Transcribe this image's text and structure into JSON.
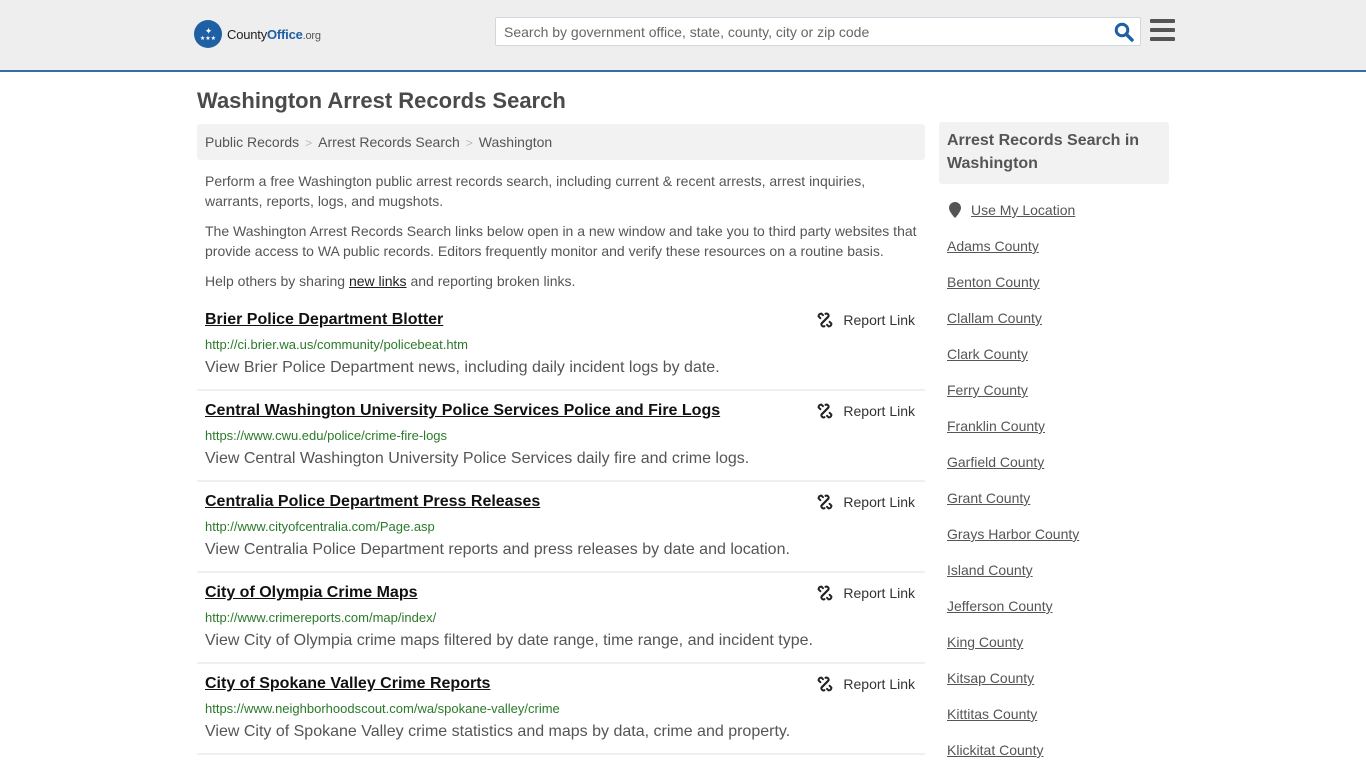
{
  "header": {
    "logo": {
      "brand_prefix": "County",
      "brand_office": "Office",
      "brand_tld": ".org",
      "wing_glyph": "✦",
      "stars_glyph": "★★★"
    },
    "search": {
      "placeholder": "Search by government office, state, county, city or zip code",
      "value": ""
    },
    "icons": {
      "search": "search-icon",
      "menu": "hamburger-menu-icon"
    }
  },
  "page": {
    "title": "Washington Arrest Records Search"
  },
  "breadcrumb": [
    {
      "label": "Public Records"
    },
    {
      "label": "Arrest Records Search"
    },
    {
      "label": "Washington"
    }
  ],
  "breadcrumb_separator": ">",
  "intro": {
    "p1": "Perform a free Washington public arrest records search, including current & recent arrests, arrest inquiries, warrants, reports, logs, and mugshots.",
    "p2": "The Washington Arrest Records Search links below open in a new window and take you to third party websites that provide access to WA public records. Editors frequently monitor and verify these resources on a routine basis.",
    "p3_before": "Help others by sharing ",
    "p3_link": "new links",
    "p3_after": " and reporting broken links."
  },
  "report_link_label": "Report Link",
  "results": [
    {
      "title": "Brier Police Department Blotter",
      "url": "http://ci.brier.wa.us/community/policebeat.htm",
      "description": "View Brier Police Department news, including daily incident logs by date."
    },
    {
      "title": "Central Washington University Police Services Police and Fire Logs",
      "url": "https://www.cwu.edu/police/crime-fire-logs",
      "description": "View Central Washington University Police Services daily fire and crime logs."
    },
    {
      "title": "Centralia Police Department Press Releases",
      "url": "http://www.cityofcentralia.com/Page.asp",
      "description": "View Centralia Police Department reports and press releases by date and location."
    },
    {
      "title": "City of Olympia Crime Maps",
      "url": "http://www.crimereports.com/map/index/",
      "description": "View City of Olympia crime maps filtered by date range, time range, and incident type."
    },
    {
      "title": "City of Spokane Valley Crime Reports",
      "url": "https://www.neighborhoodscout.com/wa/spokane-valley/crime",
      "description": "View City of Spokane Valley crime statistics and maps by data, crime and property."
    }
  ],
  "sidebar": {
    "heading": "Arrest Records Search in Washington",
    "use_location": "Use My Location",
    "counties": [
      "Adams County",
      "Benton County",
      "Clallam County",
      "Clark County",
      "Ferry County",
      "Franklin County",
      "Garfield County",
      "Grant County",
      "Grays Harbor County",
      "Island County",
      "Jefferson County",
      "King County",
      "Kitsap County",
      "Kittitas County",
      "Klickitat County"
    ]
  },
  "colors": {
    "brand_blue": "#1f5fa3",
    "header_bg": "#eeeeee",
    "header_border": "#2f70a8",
    "url_green": "#2a7a2a",
    "text_gray": "#555555"
  }
}
